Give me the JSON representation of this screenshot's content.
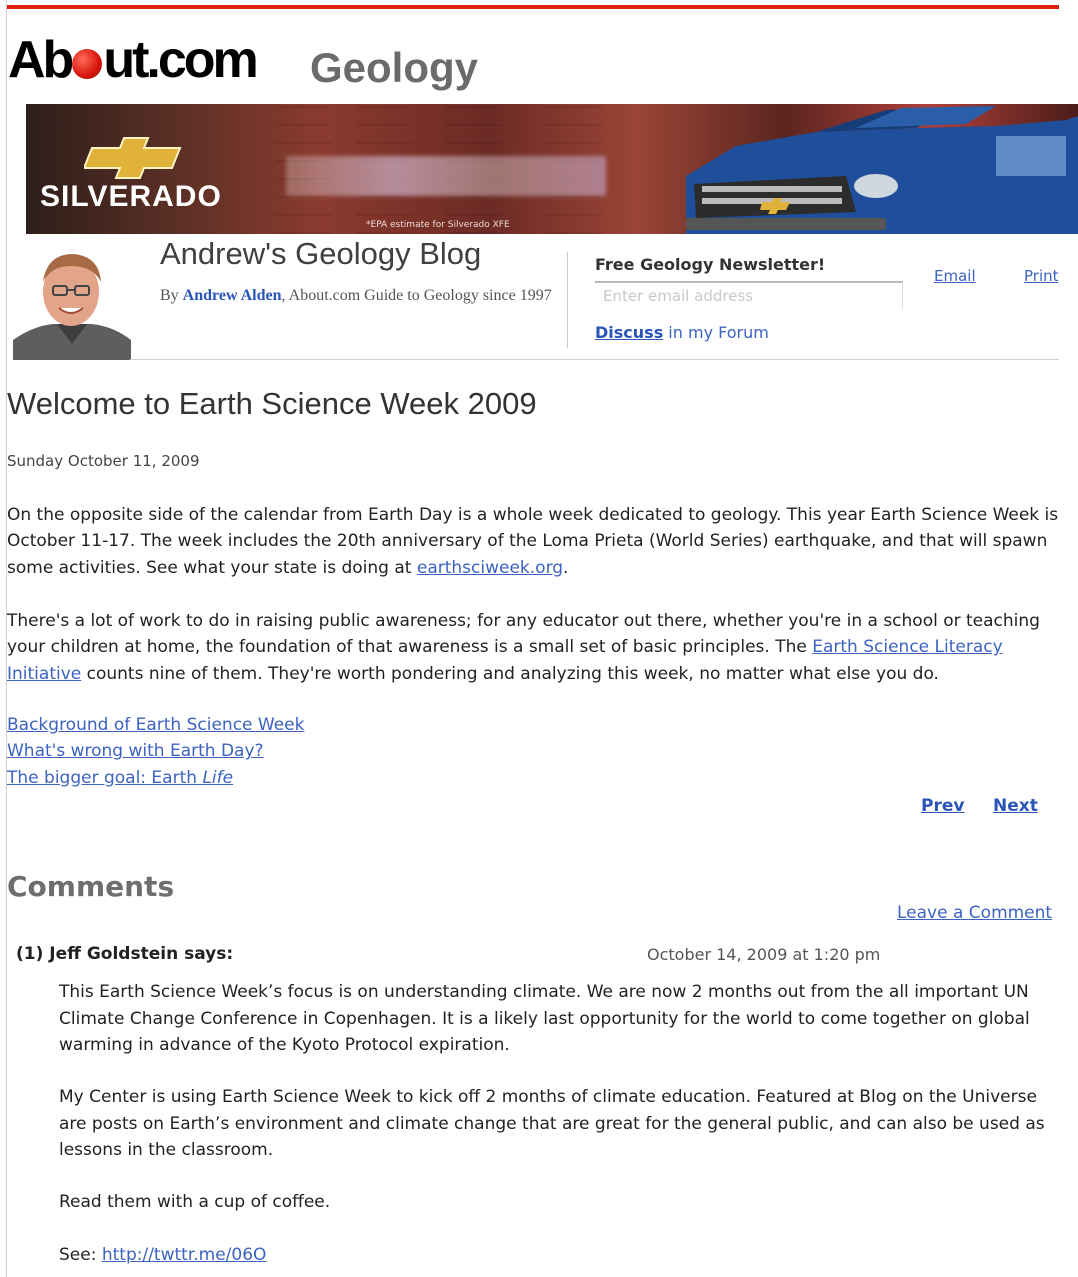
{
  "site": {
    "brand": "About.com",
    "section": "Geology"
  },
  "ad": {
    "brand": "SILVERADO",
    "blurred_text": "",
    "fine_print": "*EPA estimate for Silverado XFE"
  },
  "blog": {
    "title": "Andrew's Geology Blog",
    "byline_prefix": "By ",
    "author": "Andrew Alden",
    "byline_suffix": ", About.com Guide to Geology since 1997"
  },
  "newsletter": {
    "label": "Free Geology Newsletter!",
    "placeholder": "Enter email address",
    "value": ""
  },
  "forum": {
    "discuss": "Discuss",
    "rest": " in my Forum"
  },
  "tools": {
    "email": "Email",
    "print": "Print"
  },
  "article": {
    "title": "Welcome to Earth Science Week 2009",
    "date": "Sunday October 11, 2009",
    "p1": "On the opposite side of the calendar from Earth Day is a whole week dedicated to geology. This year Earth Science Week is October 11-17. The week includes the 20th anniversary of the Loma Prieta (World Series) earthquake, and that will spawn some activities. See what your state is doing at ",
    "p1_link": "earthsciweek.org",
    "p1_end": ".",
    "p2": "There's a lot of work to do in raising public awareness; for any educator out there, whether you're in a school or teaching your children at home, the foundation of that awareness is a small set of basic principles. The ",
    "p2_link": "Earth Science Literacy Initiative",
    "p2_end": " counts nine of them. They're worth pondering and analyzing this week, no matter what else you do.",
    "related": [
      {
        "text": "Background of Earth Science Week"
      },
      {
        "text": "What's wrong with Earth Day?"
      },
      {
        "text": "The bigger goal: Earth ",
        "em": "Life"
      }
    ]
  },
  "pager": {
    "prev": "Prev",
    "next": "Next"
  },
  "comments": {
    "heading": "Comments",
    "leave": "Leave a Comment",
    "items": [
      {
        "number": "(1)",
        "author": "Jeff Goldstein says:",
        "time": "October 14, 2009 at 1:20 pm",
        "paragraphs": [
          "This Earth Science Week’s focus is on understanding climate. We are now 2 months out from the all important UN Climate Change Conference in Copenhagen. It is a likely last opportunity for the world to come together on global warming in advance of the Kyoto Protocol expiration.",
          "My Center is using Earth Science Week to kick off 2 months of climate education. Featured at Blog on the Universe are posts on Earth’s environment and climate change that are great for the general public, and can also be used as lessons in the classroom.",
          "Read them with a cup of coffee."
        ],
        "see_label": "See: ",
        "see_link": "http://twttr.me/06O"
      }
    ]
  },
  "colors": {
    "accent_red": "#e01e12",
    "link": "#3c63c2",
    "ad_truck": "#1f4f9a"
  }
}
